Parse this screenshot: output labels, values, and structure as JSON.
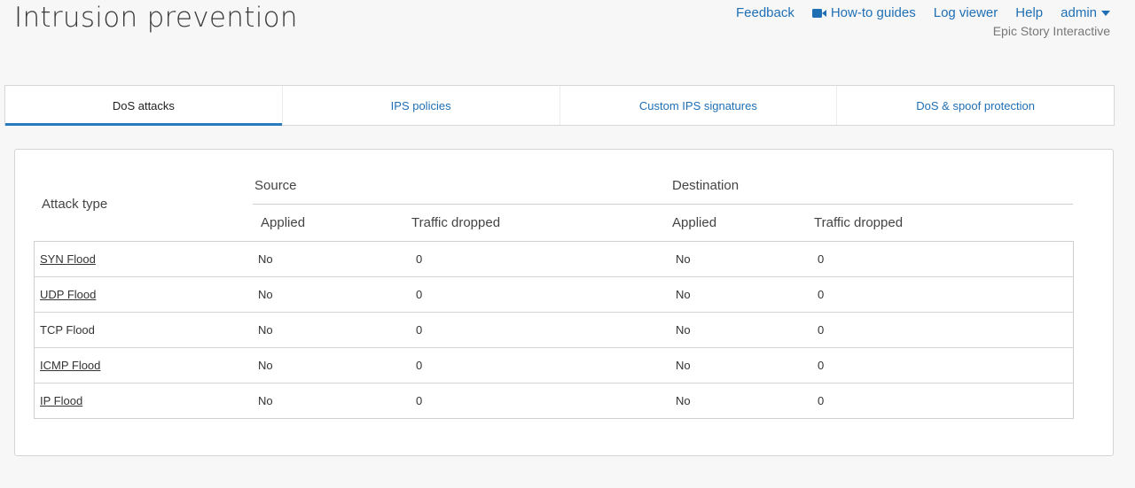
{
  "page": {
    "title": "Intrusion prevention",
    "org": "Epic Story Interactive"
  },
  "top_nav": {
    "feedback": "Feedback",
    "guides": "How-to guides",
    "log_viewer": "Log viewer",
    "help": "Help",
    "admin": "admin",
    "accent_color": "#1f6fb5",
    "guides_icon": "video-camera-icon",
    "admin_icon": "caret-down-icon"
  },
  "tabs": [
    {
      "label": "DoS attacks",
      "active": true
    },
    {
      "label": "IPS policies",
      "active": false
    },
    {
      "label": "Custom IPS signatures",
      "active": false
    },
    {
      "label": "DoS & spoof protection",
      "active": false
    }
  ],
  "table": {
    "attack_type_header": "Attack type",
    "source_header": "Source",
    "destination_header": "Destination",
    "applied_header": "Applied",
    "traffic_dropped_header": "Traffic dropped",
    "rows": [
      {
        "type": "SYN Flood",
        "link": true,
        "src_applied": "No",
        "src_dropped": "0",
        "dst_applied": "No",
        "dst_dropped": "0"
      },
      {
        "type": "UDP Flood",
        "link": true,
        "src_applied": "No",
        "src_dropped": "0",
        "dst_applied": "No",
        "dst_dropped": "0"
      },
      {
        "type": "TCP Flood",
        "link": false,
        "src_applied": "No",
        "src_dropped": "0",
        "dst_applied": "No",
        "dst_dropped": "0"
      },
      {
        "type": "ICMP Flood",
        "link": true,
        "src_applied": "No",
        "src_dropped": "0",
        "dst_applied": "No",
        "dst_dropped": "0"
      },
      {
        "type": "IP Flood",
        "link": true,
        "src_applied": "No",
        "src_dropped": "0",
        "dst_applied": "No",
        "dst_dropped": "0"
      }
    ]
  }
}
